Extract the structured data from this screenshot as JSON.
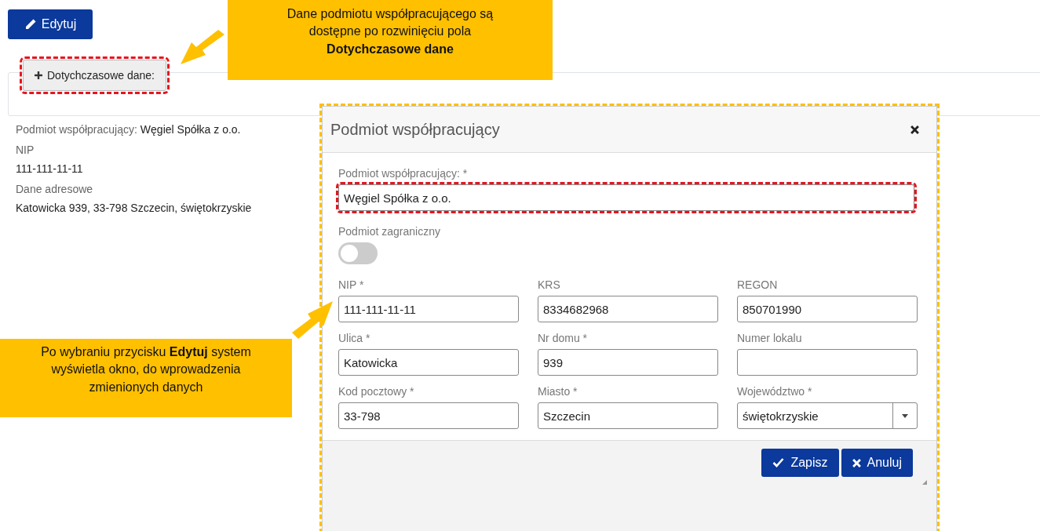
{
  "edit_button": {
    "label": "Edytuj"
  },
  "history_toggle": {
    "label": "Dotychczasowe dane:",
    "expanded": false,
    "highlighted": true
  },
  "details": [
    {
      "kind": "inline",
      "label": "Podmiot współpracujący:",
      "value": "Węgiel Spółka z o.o."
    },
    {
      "kind": "stacked",
      "label": "NIP",
      "value": "111-111-11-11"
    },
    {
      "kind": "stacked",
      "label": "Dane adresowe",
      "value": "Katowicka 939, 33-798 Szczecin, świętokrzyskie"
    }
  ],
  "modal": {
    "title": "Podmiot współpracujący",
    "highlighted": true,
    "name_field": {
      "label": "Podmiot współpracujący: *",
      "value": "Węgiel Spółka z o.o.",
      "highlighted": true
    },
    "foreign_toggle": {
      "label": "Podmiot zagraniczny",
      "on": false
    },
    "fields": [
      {
        "kind": "text",
        "label": "NIP *",
        "value": "111-111-11-11"
      },
      {
        "kind": "text",
        "label": "KRS",
        "value": "8334682968"
      },
      {
        "kind": "text",
        "label": "REGON",
        "value": "850701990"
      },
      {
        "kind": "text",
        "label": "Ulica *",
        "value": "Katowicka"
      },
      {
        "kind": "text",
        "label": "Nr domu *",
        "value": "939"
      },
      {
        "kind": "text",
        "label": "Numer lokalu"
      },
      {
        "kind": "text",
        "label": "Kod pocztowy *",
        "value": "33-798"
      },
      {
        "kind": "text",
        "label": "Miasto *",
        "value": "Szczecin"
      },
      {
        "kind": "select",
        "label": "Województwo *",
        "value": "świętokrzyskie"
      }
    ],
    "buttons": [
      {
        "kind": "save",
        "label": "Zapisz"
      },
      {
        "kind": "cancel",
        "label": "Anuluj"
      }
    ]
  },
  "callouts": [
    {
      "kind": "top",
      "text": "Dane podmiotu współpracującego są\ndostępne po rozwinięciu pola\n**Dotychczasowe dane**"
    },
    {
      "kind": "left",
      "text": "Po wybraniu przycisku **Edytuj** system\nwyświetla okno, do wprowadzenia\nzmienionych danych"
    }
  ]
}
